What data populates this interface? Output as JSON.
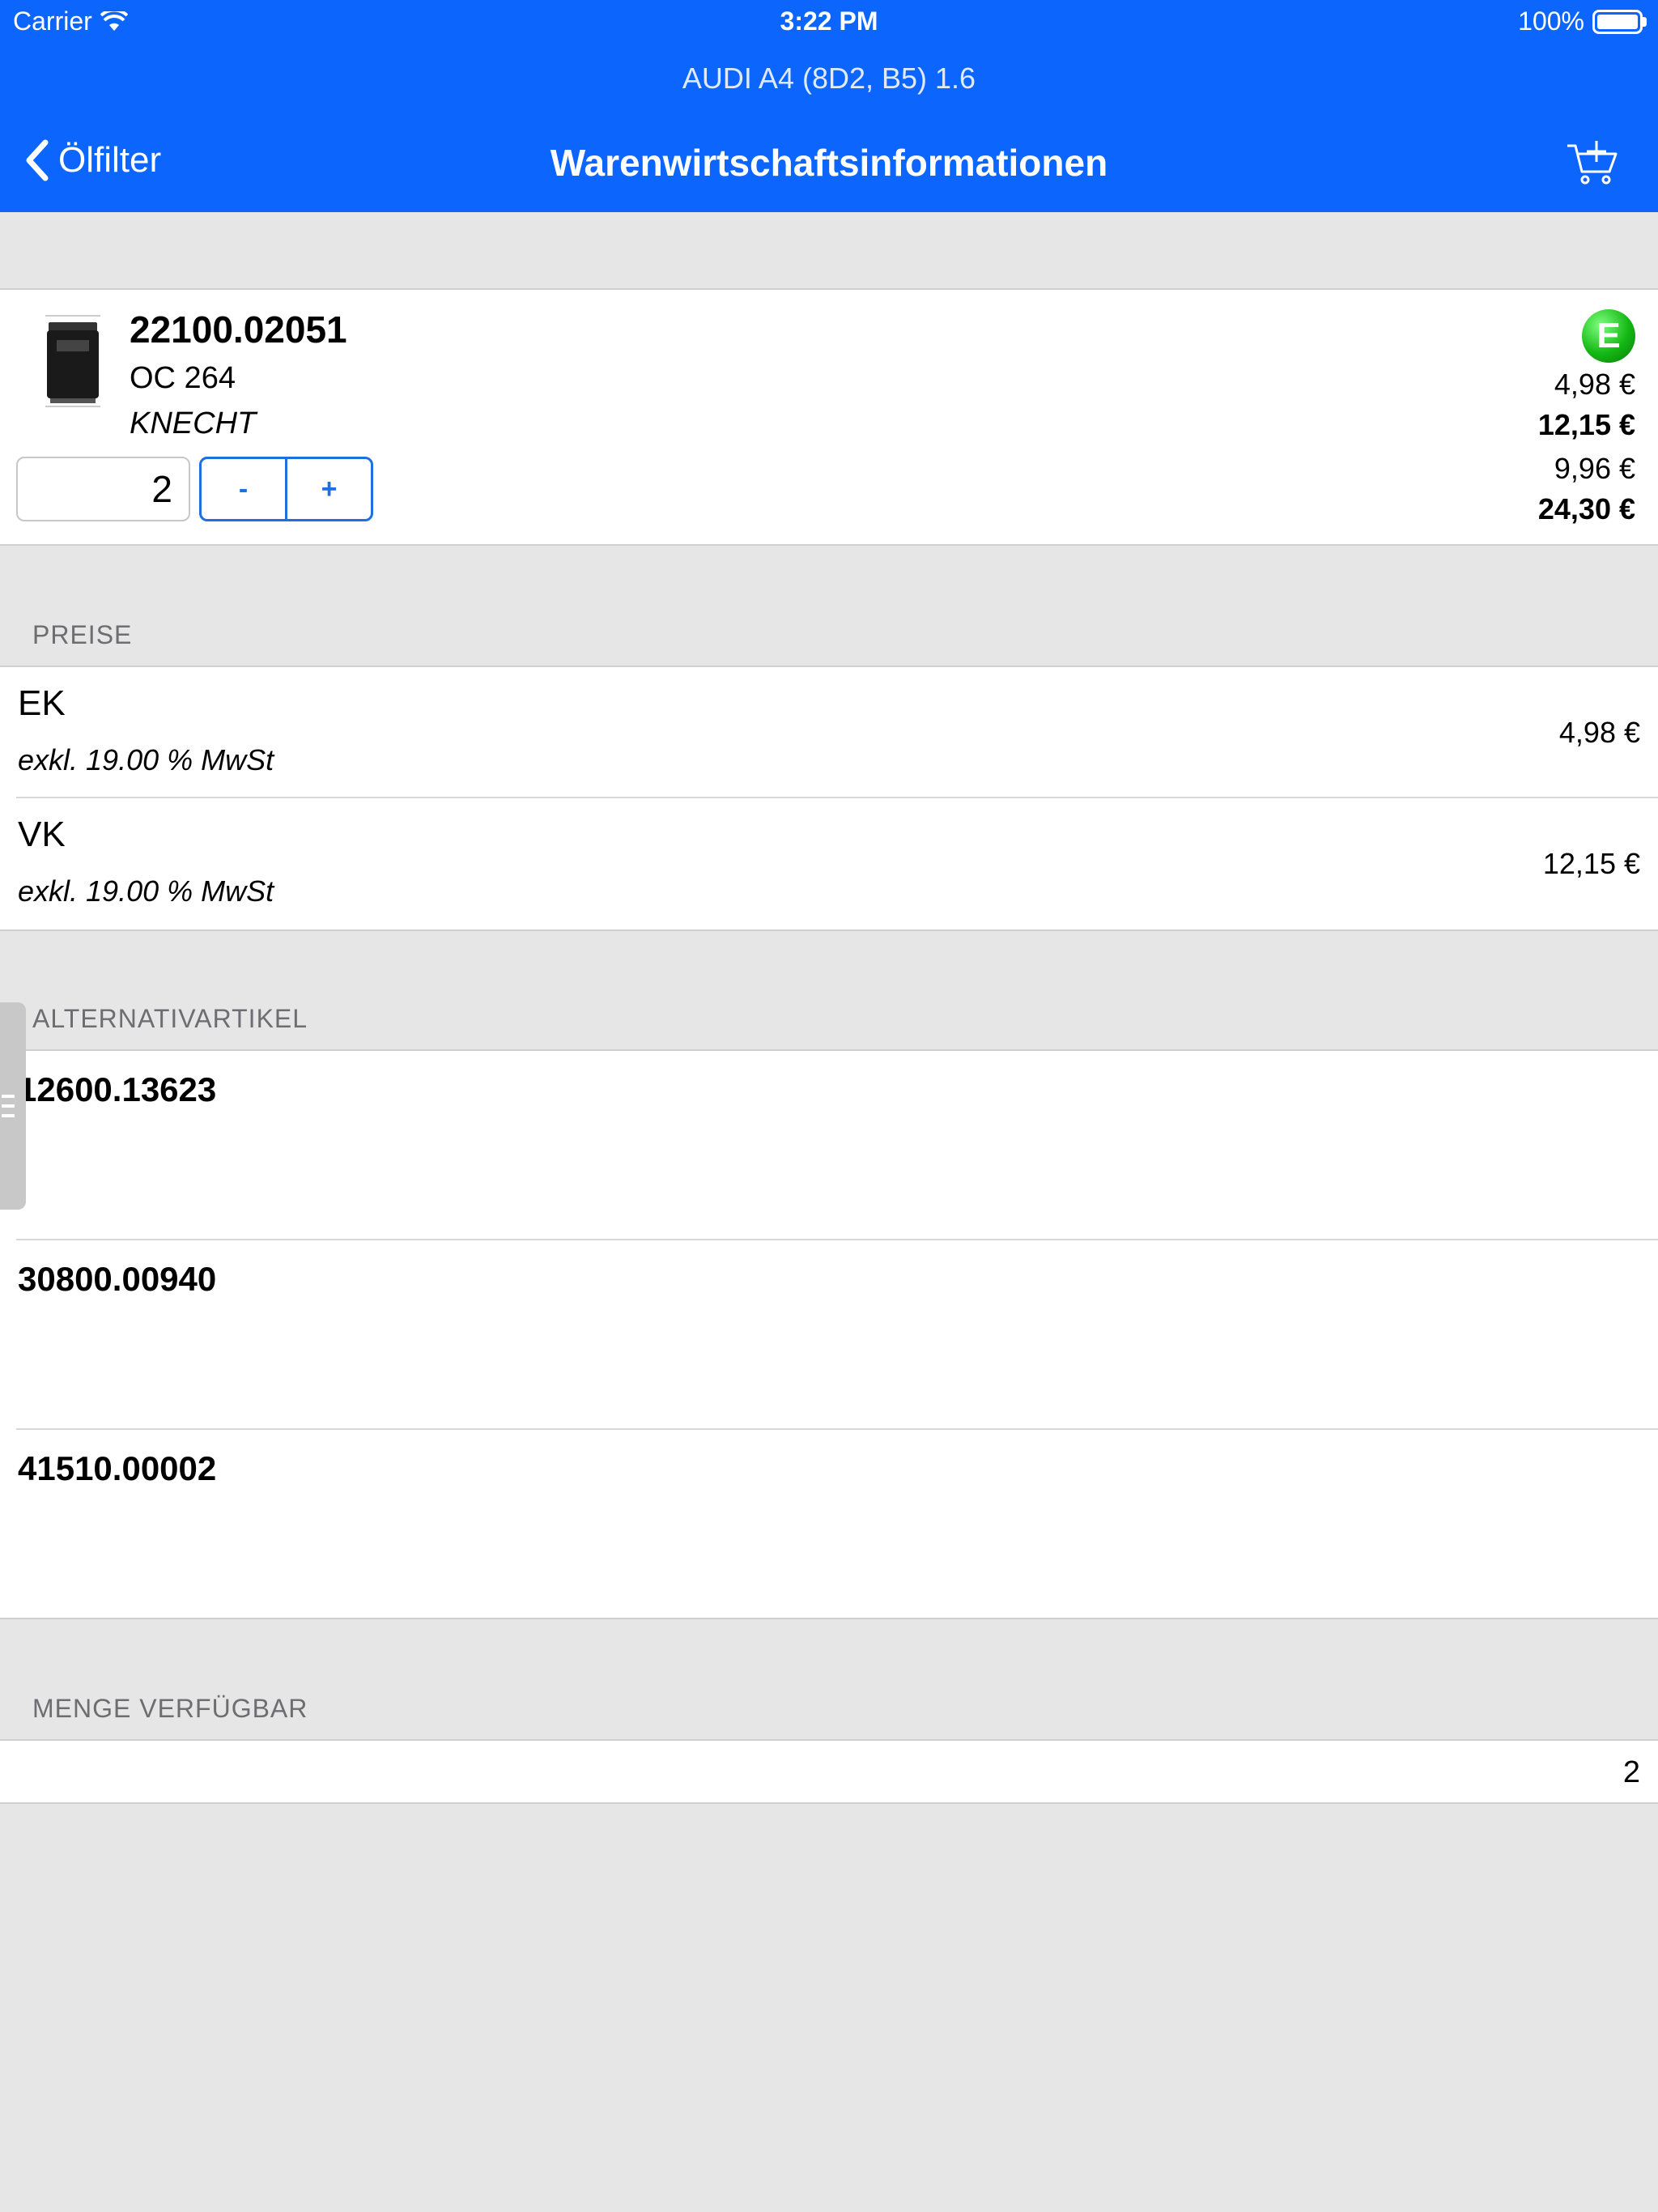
{
  "status_bar": {
    "carrier": "Carrier",
    "time": "3:22 PM",
    "battery": "100%"
  },
  "header": {
    "vehicle": "AUDI A4 (8D2, B5) 1.6",
    "back_label": "Ölfilter",
    "title": "Warenwirtschaftsinformationen"
  },
  "product": {
    "number": "22100.02051",
    "code": "OC 264",
    "brand": "KNECHT",
    "quantity": "2",
    "minus": "-",
    "plus": "+",
    "badge": "E",
    "badge_color": "#14b814",
    "price_unit_ek": "4,98 €",
    "price_unit_vk": "12,15 €",
    "price_total_ek": "9,96 €",
    "price_total_vk": "24,30 €"
  },
  "preise": {
    "header": "PREISE",
    "rows": [
      {
        "label": "EK",
        "note": "exkl. 19.00 % MwSt",
        "value": "4,98 €"
      },
      {
        "label": "VK",
        "note": "exkl. 19.00 % MwSt",
        "value": "12,15 €"
      }
    ]
  },
  "alternativ": {
    "header": "ALTERNATIVARTIKEL",
    "items": [
      "12600.13623",
      "30800.00940",
      "41510.00002"
    ]
  },
  "menge": {
    "header": "MENGE VERFÜGBAR",
    "value": "2"
  },
  "colors": {
    "accent": "#0c66fe",
    "background": "#e6e6e6"
  }
}
